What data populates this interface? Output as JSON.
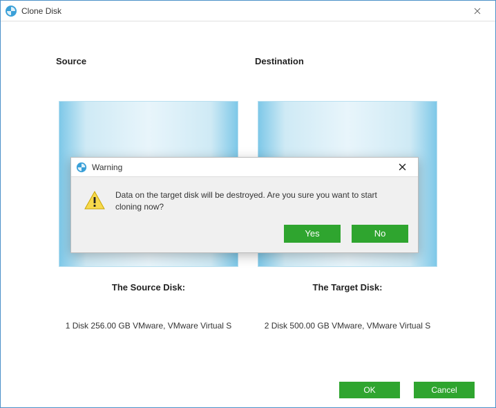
{
  "window": {
    "title": "Clone Disk"
  },
  "headers": {
    "source": "Source",
    "destination": "Destination"
  },
  "source": {
    "label": "The Source Disk:",
    "desc": "1 Disk 256.00 GB VMware,  VMware Virtual S"
  },
  "target": {
    "label": "The Target Disk:",
    "desc": "2 Disk 500.00 GB VMware,  VMware Virtual S"
  },
  "footer": {
    "ok": "OK",
    "cancel": "Cancel"
  },
  "dialog": {
    "title": "Warning",
    "message": "Data on the target disk will be destroyed. Are you sure you want to start cloning now?",
    "yes": "Yes",
    "no": "No"
  },
  "colors": {
    "primary_green": "#2fa52f"
  }
}
